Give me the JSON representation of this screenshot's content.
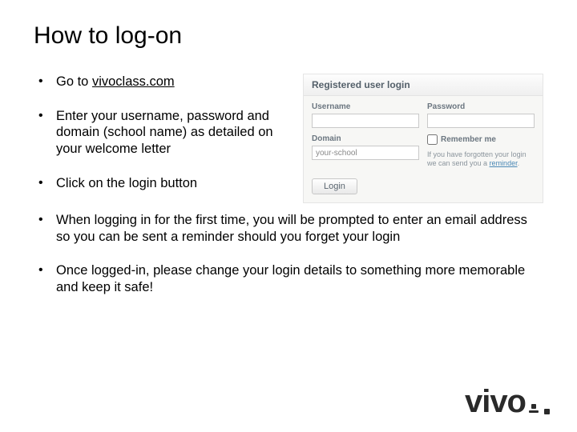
{
  "title": "How to log-on",
  "left_bullets": [
    {
      "prefix": "Go to ",
      "link": "vivoclass.com"
    },
    {
      "text": "Enter your username, password and domain (school name) as detailed on your welcome letter"
    },
    {
      "text": "Click on the login button"
    }
  ],
  "lower_bullets": [
    {
      "text": "When logging in for the first time, you will be prompted to enter an email address so you can be sent a reminder should you forget your login"
    },
    {
      "text": "Once logged-in, please change your login details to something more memorable and keep it safe!"
    }
  ],
  "panel": {
    "title": "Registered user login",
    "username_label": "Username",
    "password_label": "Password",
    "domain_label": "Domain",
    "domain_value": "your-school",
    "remember_label": "Remember me",
    "forgot_text": "If you have forgotten your login we can send you a ",
    "forgot_link": "reminder",
    "login_button": "Login"
  },
  "logo_text": "vivo"
}
